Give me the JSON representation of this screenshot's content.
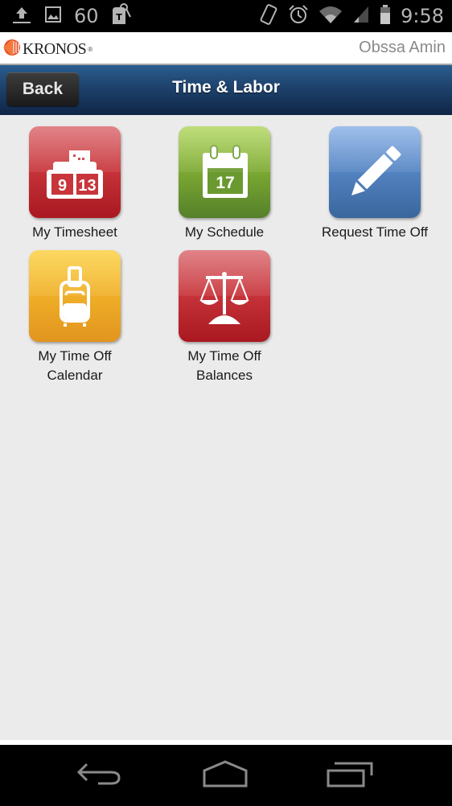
{
  "status_bar": {
    "left_icons": [
      "upload-icon",
      "image-icon",
      "t-mobile-icon"
    ],
    "notification_count": "60",
    "right_icons": [
      "rotate-icon",
      "alarm-icon",
      "wifi-icon",
      "signal-icon",
      "battery-icon"
    ],
    "time": "9:58"
  },
  "brand": {
    "name": "KRONOS",
    "registered": "®",
    "user_name": "Obssa Amin"
  },
  "header": {
    "back_label": "Back",
    "title": "Time & Labor"
  },
  "tiles": [
    {
      "label": "My Timesheet",
      "icon": "timesheet-clock-icon",
      "color": "#c8353b",
      "digits": [
        "9",
        "13"
      ]
    },
    {
      "label": "My Schedule",
      "icon": "calendar-icon",
      "color": "#7fac33",
      "day": "17"
    },
    {
      "label": "Request Time Off",
      "icon": "pencil-icon",
      "color": "#5585c4"
    },
    {
      "label_lines": [
        "My Time Off",
        "Calendar"
      ],
      "icon": "suitcase-icon",
      "color": "#f0b128"
    },
    {
      "label_lines": [
        "My Time Off",
        "Balances"
      ],
      "icon": "scales-icon",
      "color": "#c8353b"
    }
  ],
  "nav_bar": {
    "buttons": [
      "back-icon",
      "home-icon",
      "recent-apps-icon"
    ]
  }
}
